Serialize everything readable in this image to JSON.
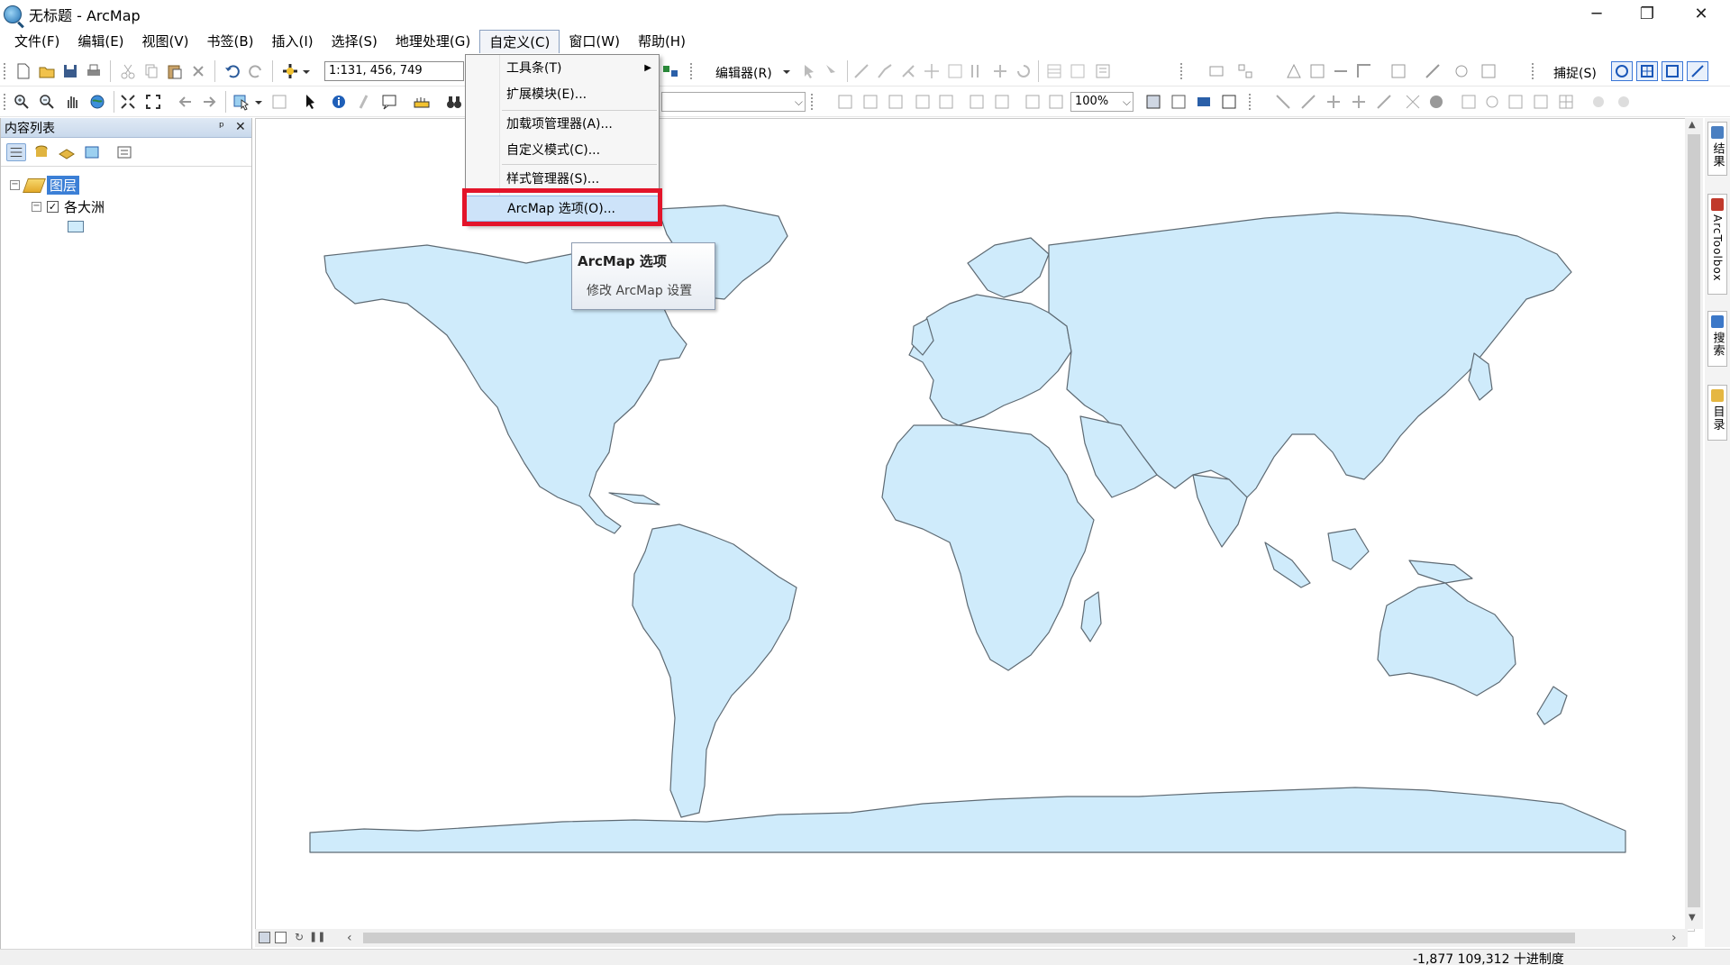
{
  "window": {
    "title": "无标题 - ArcMap",
    "controls": {
      "minimize": "─",
      "restore": "❐",
      "close": "✕"
    }
  },
  "menubar": {
    "items": [
      "文件(F)",
      "编辑(E)",
      "视图(V)",
      "书签(B)",
      "插入(I)",
      "选择(S)",
      "地理处理(G)",
      "自定义(C)",
      "窗口(W)",
      "帮助(H)"
    ],
    "open_item": "自定义(C)"
  },
  "toolbar": {
    "scale": "1:131, 456, 749",
    "editor_label": "编辑器(R)",
    "zoom_percent": "100%",
    "snapping_label": "捕捉(S)"
  },
  "customize_menu": {
    "items": [
      {
        "label": "工具条(T)",
        "has_submenu": true
      },
      {
        "label": "扩展模块(E)..."
      },
      {
        "label": "加载项管理器(A)..."
      },
      {
        "label": "自定义模式(C)..."
      },
      {
        "label": "样式管理器(S)..."
      },
      {
        "label": "ArcMap 选项(O)...",
        "highlighted": true
      }
    ]
  },
  "tooltip": {
    "title": "ArcMap 选项",
    "description": "修改 ArcMap 设置"
  },
  "toc": {
    "title": "内容列表",
    "pin": "ᵖ",
    "close": "✕",
    "root_label": "图层",
    "layer_label": "各大洲",
    "layer_checked": "✓"
  },
  "right_dock": {
    "tabs": [
      "结果",
      "ArcToolbox",
      "搜索",
      "目录"
    ]
  },
  "status": {
    "coordinates": "-1,877 109,312 十进制度"
  },
  "colors": {
    "land_fill": "#cfebfb",
    "land_stroke": "#5e6a73",
    "highlight_box": "#e3142a",
    "selection": "#3b7fd6"
  }
}
